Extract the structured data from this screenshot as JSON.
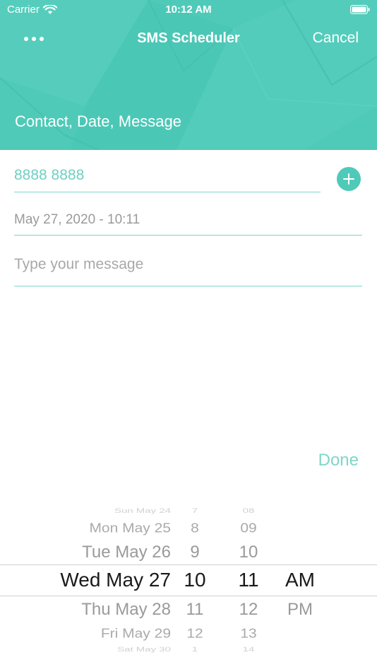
{
  "status_bar": {
    "carrier": "Carrier",
    "time": "10:12 AM"
  },
  "nav": {
    "title": "SMS Scheduler",
    "cancel_label": "Cancel",
    "more_icon": "ellipsis-icon"
  },
  "header": {
    "subtitle": "Contact, Date, Message"
  },
  "form": {
    "phone_value": "8888 8888",
    "date_value": "May 27, 2020 - 10:11",
    "message_placeholder": "Type your message",
    "add_contact_icon": "plus-circle-icon"
  },
  "done_label": "Done",
  "picker": {
    "dates": [
      "Sun May 24",
      "Mon May 25",
      "Tue May 26",
      "Wed May 27",
      "Thu May 28",
      "Fri May 29",
      "Sat May 30"
    ],
    "hours": [
      "7",
      "8",
      "9",
      "10",
      "11",
      "12",
      "1"
    ],
    "minutes": [
      "08",
      "09",
      "10",
      "11",
      "12",
      "13",
      "14"
    ],
    "ampm": [
      "AM",
      "PM"
    ]
  },
  "colors": {
    "accent": "#4fcab9",
    "line": "#7fd6c9"
  }
}
